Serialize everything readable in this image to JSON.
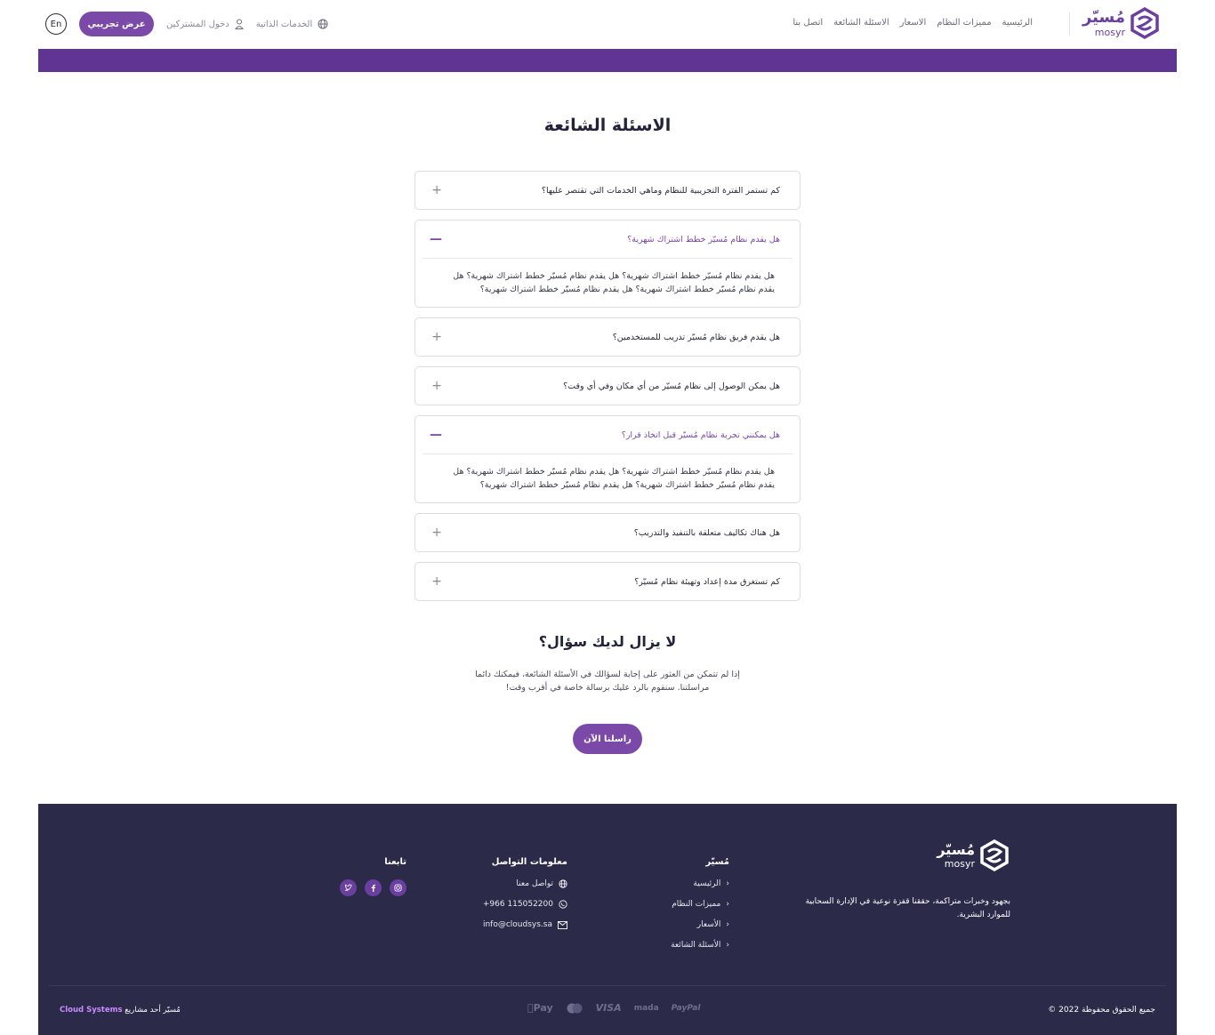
{
  "header": {
    "logo_ar": "مُسيّر",
    "logo_en": "mosyr",
    "nav": [
      "الرئيسية",
      "مميزات النظام",
      "الاسعار",
      "الاسئلة الشائعة",
      "اتصل بنا"
    ],
    "lang_button": "En",
    "demo_button": "عرض تجريبي",
    "subscribers_login": "دخول المشتركين",
    "self_services": "الخدمات الذاتية"
  },
  "page": {
    "title": "الاسئلة الشائعة"
  },
  "faq": [
    {
      "question": "كم تستمر الفترة التجريبية للنظام وماهي الخدمات التي تقتصر عليها؟",
      "open": false,
      "answer": ""
    },
    {
      "question": "هل يقدم نظام مُسيّر خطط اشتراك شهرية؟",
      "open": true,
      "answer": "هل يقدم نظام مُسيّر خطط اشتراك شهرية؟ هل يقدم نظام مُسيّر خطط اشتراك شهرية؟ هل يقدم نظام مُسيّر خطط اشتراك شهرية؟ هل يقدم نظام مُسيّر خطط اشتراك شهرية؟"
    },
    {
      "question": "هل يقدم فريق نظام مُسيّر تدريب للمستخدمين؟",
      "open": false,
      "answer": ""
    },
    {
      "question": "هل يمكن الوصول إلى نظام مُسيّر من أي مكان وفي أي وقت؟",
      "open": false,
      "answer": ""
    },
    {
      "question": "هل يمكنني تجربة نظام مُسيّر قبل اتخاذ قرار؟",
      "open": true,
      "answer": "هل يقدم نظام مُسيّر خطط اشتراك شهرية؟ هل يقدم نظام مُسيّر خطط اشتراك شهرية؟ هل يقدم نظام مُسيّر خطط اشتراك شهرية؟ هل يقدم نظام مُسيّر خطط اشتراك شهرية؟"
    },
    {
      "question": "هل هناك تكاليف متعلقة بالتنفيذ والتدريب؟",
      "open": false,
      "answer": ""
    },
    {
      "question": "كم تستغرق مدة إعداد وتهيئة نظام مُسيّر؟",
      "open": false,
      "answer": ""
    }
  ],
  "ask": {
    "title": "لا يزال لديك سؤال؟",
    "text": "إذا لم تتمكن من العثور على إجابة لسؤالك في الأسئلة الشائعة، فيمكنك دائما مراسلتنا. سنقوم بالرد عليك برسالة خاصة في أقرب وقت!",
    "button": "راسلنا الآن"
  },
  "footer": {
    "logo_ar": "مُسيّر",
    "logo_en": "mosyr",
    "description": "بجهود وخبرات متراكمة، حققنا قفزة نوعية في الإدارة السحابية للموارد البشرية.",
    "mosyr_title": "مُسيّر",
    "mosyr_links": [
      "الرئيسية",
      "مميزات النظام",
      "الأسعار",
      "الأسئلة الشائعة"
    ],
    "contact_title": "معلومات التواصل",
    "contact_us": "تواصل معنا",
    "phone": "+966 115052200",
    "email": "info@cloudsys.sa",
    "follow_title": "تابعنا",
    "copyright": "جميع الحقوق محفوظة 2022 ©",
    "credit_prefix": "مُسيّر أحد مشاريع",
    "credit_company": "Cloud Systems",
    "payments": [
      "Pay",
      "VISA",
      "mada",
      "PayPal"
    ]
  },
  "colors": {
    "primary": "#7b4aa8",
    "header_bar": "#5f3492",
    "footer_bg": "#2b2a49"
  }
}
